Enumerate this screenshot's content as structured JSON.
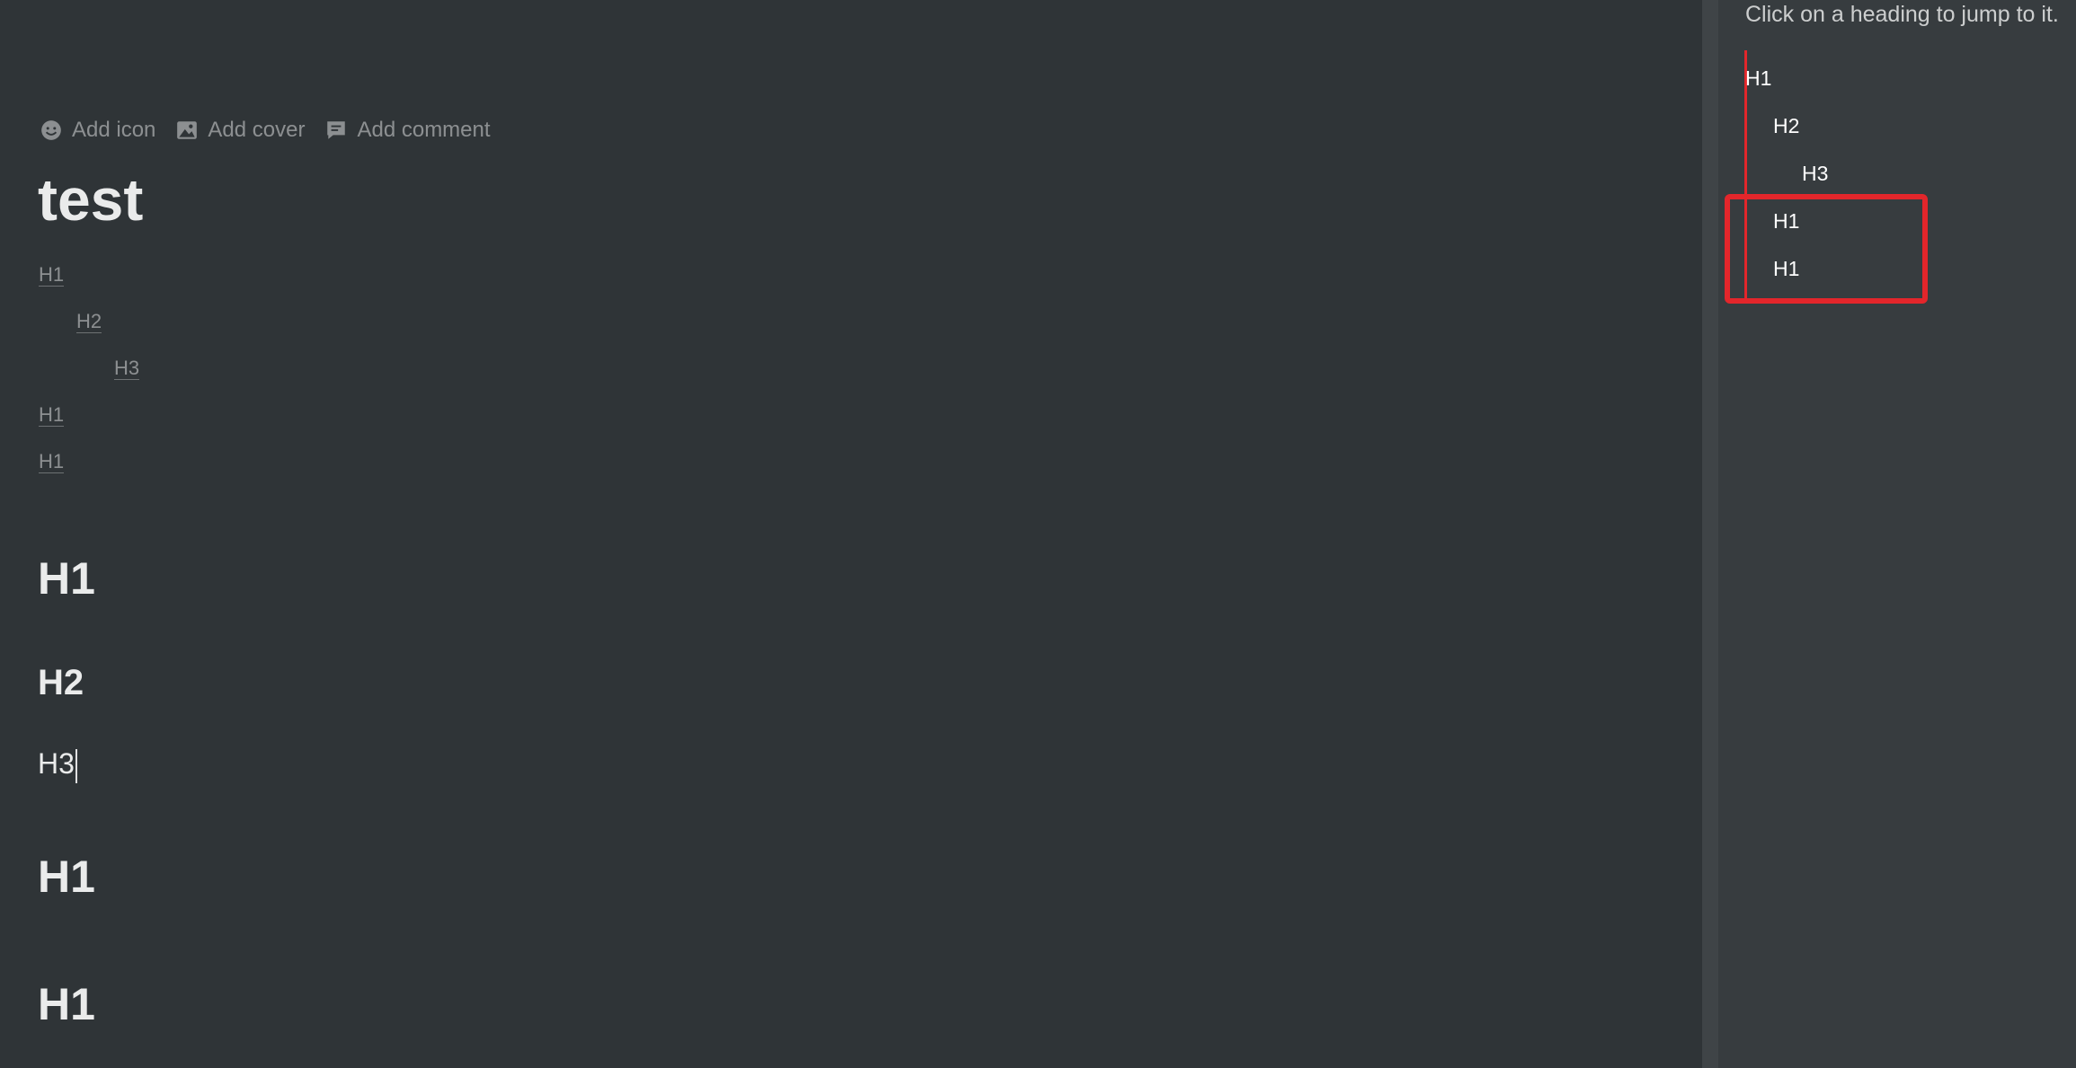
{
  "actions": {
    "add_icon": "Add icon",
    "add_cover": "Add cover",
    "add_comment": "Add comment"
  },
  "page": {
    "title": "test",
    "toc": [
      "H1",
      "H2",
      "H3",
      "H1",
      "H1"
    ],
    "headings": [
      {
        "level": 1,
        "text": "H1"
      },
      {
        "level": 2,
        "text": "H2"
      },
      {
        "level": 3,
        "text": "H3"
      },
      {
        "level": 1,
        "text": "H1"
      },
      {
        "level": 1,
        "text": "H1"
      }
    ]
  },
  "outline": {
    "hint": "Click on a heading to jump to it.",
    "items": [
      "H1",
      "H2",
      "H3",
      "H1",
      "H1"
    ]
  },
  "colors": {
    "background": "#2f3437",
    "sidebar": "#373c3f",
    "annotation": "#e3262b"
  }
}
